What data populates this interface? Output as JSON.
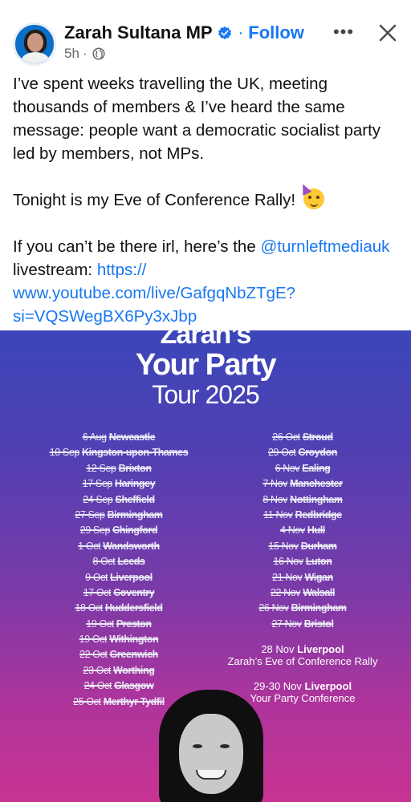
{
  "header": {
    "name": "Zarah Sultana MP",
    "separator": "·",
    "follow": "Follow",
    "time": "5h",
    "time_separator": "·"
  },
  "post": {
    "para1": "I’ve spent weeks travelling the UK, meeting thousands of members & I’ve heard the same message: people want a democratic socialist party led by members, not MPs.",
    "para2": "Tonight is my Eve of Conference Rally!",
    "para3_prefix": "If you can’t be there irl, here’s the",
    "mention": "@turnleftmediauk",
    "para3_middle": "livestream:",
    "url": "https:// www.youtube.com/live/GafgqNbZTgE? si=VQSWegBX6Py3xJbp"
  },
  "poster": {
    "top_cut": "Zarah’s",
    "title": "Your Party",
    "subtitle": "Tour 2025",
    "left_stops": [
      {
        "date": "6 Aug",
        "city": "Newcastle"
      },
      {
        "date": "10 Sep",
        "city": "Kingston-upon-Thames"
      },
      {
        "date": "12 Sep",
        "city": "Brixton"
      },
      {
        "date": "17 Sep",
        "city": "Haringey"
      },
      {
        "date": "24 Sep",
        "city": "Sheffield"
      },
      {
        "date": "27 Sep",
        "city": "Birmingham"
      },
      {
        "date": "29 Sep",
        "city": "Chingford"
      },
      {
        "date": "1 Oct",
        "city": "Wandsworth"
      },
      {
        "date": "8 Oct",
        "city": "Leeds"
      },
      {
        "date": "9 Oct",
        "city": "Liverpool"
      },
      {
        "date": "17 Oct",
        "city": "Coventry"
      },
      {
        "date": "18 Oct",
        "city": "Huddersfield"
      },
      {
        "date": "19 Oct",
        "city": "Preston"
      },
      {
        "date": "19 Oct",
        "city": "Withington"
      },
      {
        "date": "22 Oct",
        "city": "Greenwich"
      },
      {
        "date": "23 Oct",
        "city": "Worthing"
      },
      {
        "date": "24 Oct",
        "city": "Glasgow"
      },
      {
        "date": "25 Oct",
        "city": "Merthyr Tydfil"
      }
    ],
    "right_stops": [
      {
        "date": "26 Oct",
        "city": "Stroud"
      },
      {
        "date": "29 Oct",
        "city": "Croydon"
      },
      {
        "date": "6 Nov",
        "city": "Ealing"
      },
      {
        "date": "7 Nov",
        "city": "Manchester"
      },
      {
        "date": "8 Nov",
        "city": "Nottingham"
      },
      {
        "date": "11 Nov",
        "city": "Redbridge"
      },
      {
        "date": "4 Nov",
        "city": "Hull"
      },
      {
        "date": "15 Nov",
        "city": "Durham"
      },
      {
        "date": "16 Nov",
        "city": "Luton"
      },
      {
        "date": "21 Nov",
        "city": "Wigan"
      },
      {
        "date": "22 Nov",
        "city": "Walsall"
      },
      {
        "date": "26 Nov",
        "city": "Birmingham"
      },
      {
        "date": "27 Nov",
        "city": "Bristol"
      }
    ],
    "event1": {
      "date": "28 Nov",
      "city": "Liverpool",
      "caption": "Zarah’s Eve of Conference Rally"
    },
    "event2": {
      "date": "29-30 Nov",
      "city": "Liverpool",
      "caption": "Your Party Conference"
    }
  },
  "colors": {
    "link": "#1877f2",
    "verified": "#1877f2",
    "poster_top": "#3b46b9",
    "poster_bottom": "#c83392"
  },
  "icons": {
    "verified": "verified-badge-icon",
    "globe": "globe-icon",
    "more": "more-options-icon",
    "close": "close-icon"
  }
}
